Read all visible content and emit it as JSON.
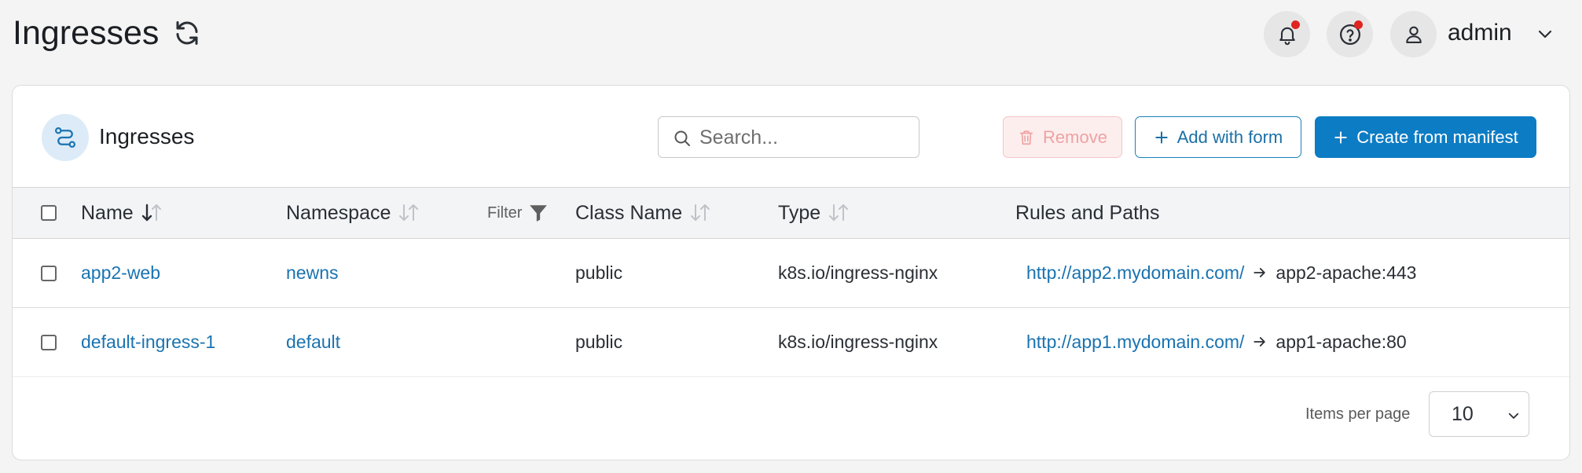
{
  "header": {
    "title": "Ingresses",
    "user_name": "admin"
  },
  "card": {
    "title": "Ingresses",
    "search_placeholder": "Search...",
    "remove_label": "Remove",
    "add_form_label": "Add with form",
    "create_manifest_label": "Create from manifest"
  },
  "table": {
    "columns": {
      "name": "Name",
      "namespace": "Namespace",
      "filter": "Filter",
      "class_name": "Class Name",
      "type": "Type",
      "rules": "Rules and Paths"
    },
    "rows": [
      {
        "name": "app2-web",
        "namespace": "newns",
        "class_name": "public",
        "type": "k8s.io/ingress-nginx",
        "rule_url": "http://app2.mydomain.com/",
        "rule_target": "app2-apache:443"
      },
      {
        "name": "default-ingress-1",
        "namespace": "default",
        "class_name": "public",
        "type": "k8s.io/ingress-nginx",
        "rule_url": "http://app1.mydomain.com/",
        "rule_target": "app1-apache:80"
      }
    ]
  },
  "pagination": {
    "items_per_page_label": "Items per page",
    "items_per_page_value": "10"
  },
  "colors": {
    "primary": "#0c7cc4",
    "link": "#1a73b0",
    "danger_soft": "#fdeeee",
    "notification_dot": "#e0241f"
  },
  "icons": {
    "refresh": "refresh-icon",
    "bell": "bell-icon",
    "help": "help-icon",
    "user": "user-icon",
    "ingress": "ingress-route-icon",
    "search": "search-icon",
    "trash": "trash-icon",
    "plus": "plus-icon",
    "sort": "sort-icon",
    "filter": "filter-icon",
    "arrow": "arrow-right-icon",
    "chevron": "chevron-down-icon"
  }
}
